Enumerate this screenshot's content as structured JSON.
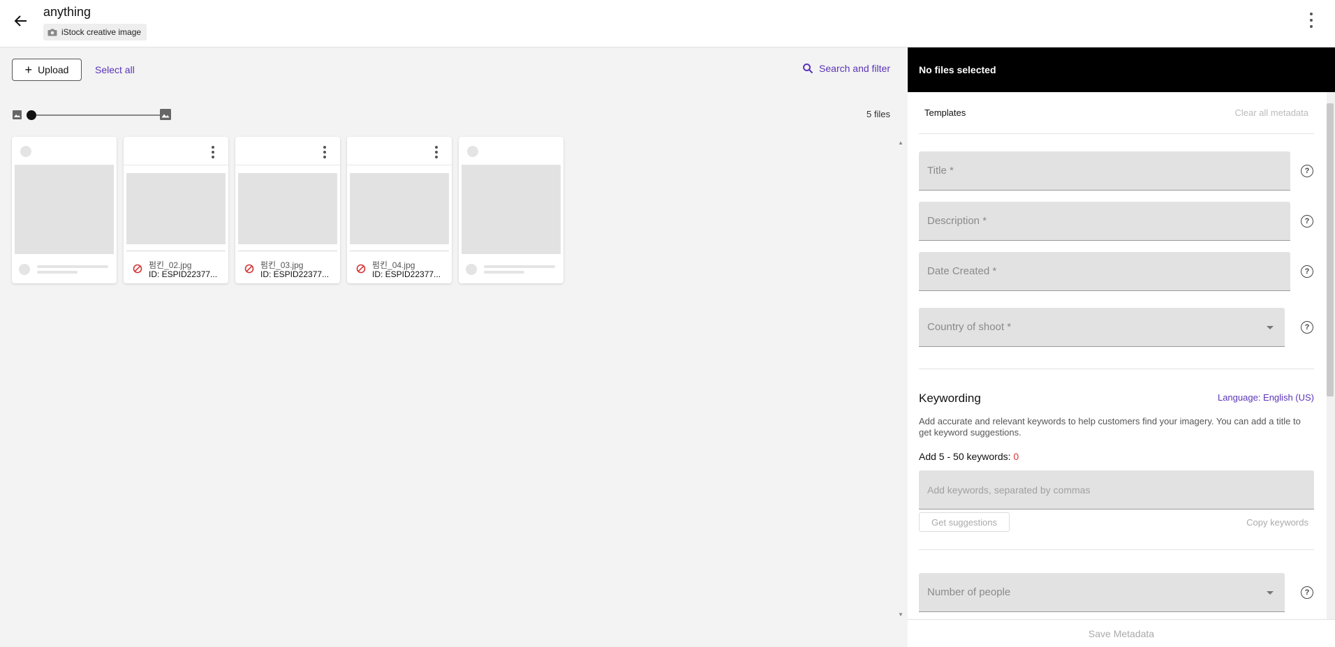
{
  "header": {
    "title": "anything",
    "chip_label": "iStock creative image"
  },
  "toolbar": {
    "upload_label": "Upload",
    "select_all_label": "Select all",
    "search_filter_label": "Search and filter",
    "file_count": "5 files",
    "thumbnail_size_level": 0
  },
  "files": [
    {
      "status": "loading"
    },
    {
      "name": "펌킨_02.jpg",
      "id": "ID: ESPID22377...",
      "status": "blocked"
    },
    {
      "name": "펌킨_03.jpg",
      "id": "ID: ESPID22377...",
      "status": "blocked"
    },
    {
      "name": "펌킨_04.jpg",
      "id": "ID: ESPID22377...",
      "status": "blocked"
    },
    {
      "status": "loading"
    }
  ],
  "panel": {
    "header": "No files selected",
    "templates_label": "Templates",
    "clear_all_label": "Clear all metadata",
    "fields": {
      "title": "Title *",
      "description": "Description *",
      "date_created": "Date Created *",
      "country": "Country of shoot *",
      "people": "Number of people"
    },
    "keywording": {
      "title": "Keywording",
      "language": "Language: English (US)",
      "description": "Add accurate and relevant keywords to help customers find your imagery. You can add a title to get keyword suggestions.",
      "count_prefix": "Add 5 - 50 keywords: ",
      "count": "0",
      "placeholder": "Add keywords, separated by commas",
      "get_suggestions": "Get suggestions",
      "copy_keywords": "Copy keywords"
    },
    "save_label": "Save Metadata"
  },
  "colors": {
    "accent": "#5a33b8",
    "error": "#d33333",
    "panel_header_bg": "#000000",
    "field_bg": "#e2e2e2"
  },
  "icons": [
    "arrow-left-icon",
    "camera-icon",
    "more-vertical-icon",
    "plus-icon",
    "search-icon",
    "image-small-icon",
    "image-large-icon",
    "ban-icon",
    "help-icon",
    "chevron-down-icon"
  ]
}
